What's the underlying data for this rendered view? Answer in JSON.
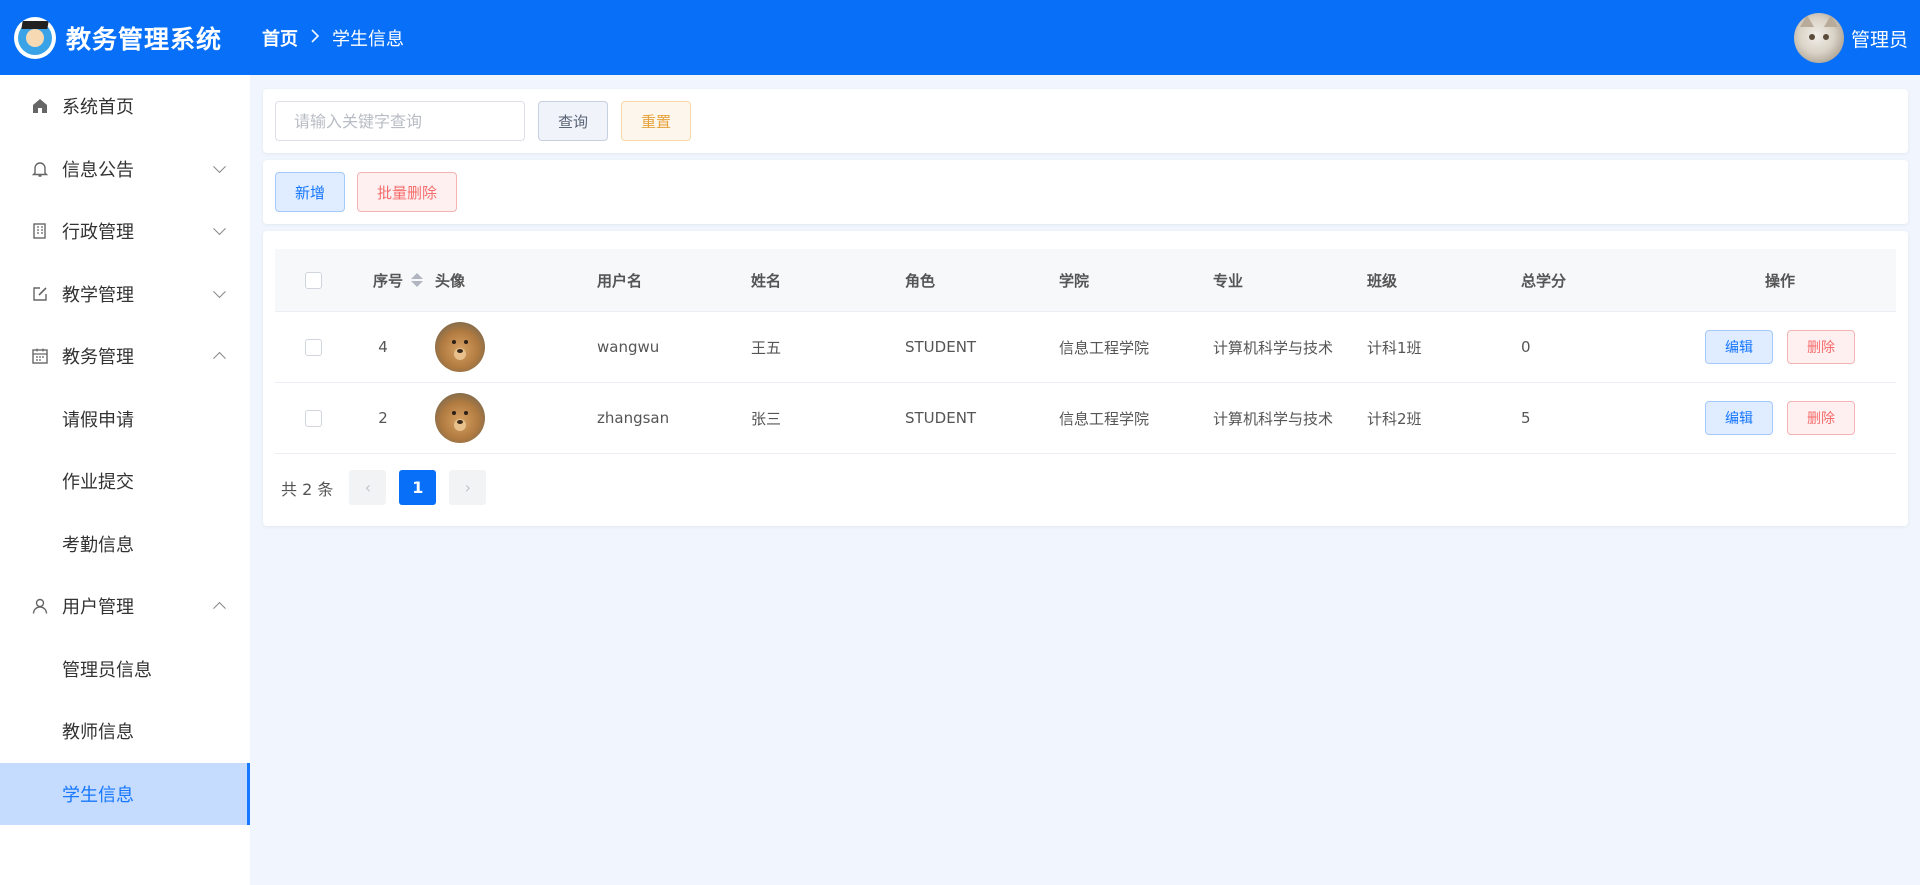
{
  "app": {
    "title": "教务管理系统",
    "logo_icon": "graduate-owl-logo"
  },
  "breadcrumb": {
    "home": "首页",
    "separator": ">",
    "current": "学生信息"
  },
  "user": {
    "name": "管理员",
    "avatar_icon": "cat-avatar"
  },
  "sidebar": {
    "items": [
      {
        "label": "系统首页",
        "icon": "home-icon",
        "expandable": false
      },
      {
        "label": "信息公告",
        "icon": "bell-icon",
        "expandable": true,
        "expanded": false
      },
      {
        "label": "行政管理",
        "icon": "building-icon",
        "expandable": true,
        "expanded": false
      },
      {
        "label": "教学管理",
        "icon": "edit-icon",
        "expandable": true,
        "expanded": false
      },
      {
        "label": "教务管理",
        "icon": "calendar-icon",
        "expandable": true,
        "expanded": true,
        "children": [
          "请假申请",
          "作业提交",
          "考勤信息"
        ]
      },
      {
        "label": "用户管理",
        "icon": "user-icon",
        "expandable": true,
        "expanded": true,
        "children": [
          "管理员信息",
          "教师信息",
          "学生信息"
        ]
      }
    ],
    "active": "学生信息"
  },
  "search": {
    "placeholder": "请输入关键字查询",
    "value": "",
    "query_label": "查询",
    "reset_label": "重置"
  },
  "actions": {
    "add_label": "新增",
    "batch_delete_label": "批量删除"
  },
  "table": {
    "headers": [
      "序号",
      "头像",
      "用户名",
      "姓名",
      "角色",
      "学院",
      "专业",
      "班级",
      "总学分",
      "操作"
    ],
    "rows": [
      {
        "index": "4",
        "username": "wangwu",
        "name": "王五",
        "role": "STUDENT",
        "college": "信息工程学院",
        "major": "计算机科学与技术",
        "class": "计科1班",
        "credits": "0"
      },
      {
        "index": "2",
        "username": "zhangsan",
        "name": "张三",
        "role": "STUDENT",
        "college": "信息工程学院",
        "major": "计算机科学与技术",
        "class": "计科2班",
        "credits": "5"
      }
    ],
    "edit_label": "编辑",
    "delete_label": "删除"
  },
  "pagination": {
    "total_text": "共 2 条",
    "current_page": "1",
    "prev": "‹",
    "next": "›"
  },
  "colors": {
    "primary": "#0870f8",
    "header_bg": "#0870f8",
    "page_bg": "#f1f5fd",
    "danger": "#f56c6c",
    "warning": "#e6a23c"
  }
}
